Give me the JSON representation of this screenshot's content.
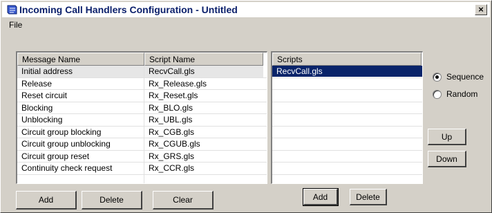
{
  "window": {
    "title": "Incoming Call Handlers Configuration - Untitled",
    "close_label": "×"
  },
  "menu": {
    "file_label": "File"
  },
  "handlers_table": {
    "columns": [
      "Message Name",
      "Script Name"
    ],
    "rows": [
      {
        "message": "Initial address",
        "script": "RecvCall.gls"
      },
      {
        "message": "Release",
        "script": "Rx_Release.gls"
      },
      {
        "message": "Reset circuit",
        "script": "Rx_Reset.gls"
      },
      {
        "message": "Blocking",
        "script": "Rx_BLO.gls"
      },
      {
        "message": "Unblocking",
        "script": "Rx_UBL.gls"
      },
      {
        "message": "Circuit group blocking",
        "script": "Rx_CGB.gls"
      },
      {
        "message": "Circuit group unblocking",
        "script": "Rx_CGUB.gls"
      },
      {
        "message": "Circuit group reset",
        "script": "Rx_GRS.gls"
      },
      {
        "message": "Continuity check request",
        "script": "Rx_CCR.gls"
      }
    ]
  },
  "scripts_list": {
    "header": "Scripts",
    "items": [
      "RecvCall.gls"
    ]
  },
  "order": {
    "sequence_label": "Sequence",
    "random_label": "Random",
    "selected": "Sequence"
  },
  "buttons": {
    "add": "Add",
    "delete": "Delete",
    "clear": "Clear",
    "scripts_add": "Add",
    "scripts_delete": "Delete",
    "up": "Up",
    "down": "Down"
  },
  "colors": {
    "selection": "#0a246a",
    "title_text": "#0a1f6b",
    "face": "#d4d0c8"
  }
}
